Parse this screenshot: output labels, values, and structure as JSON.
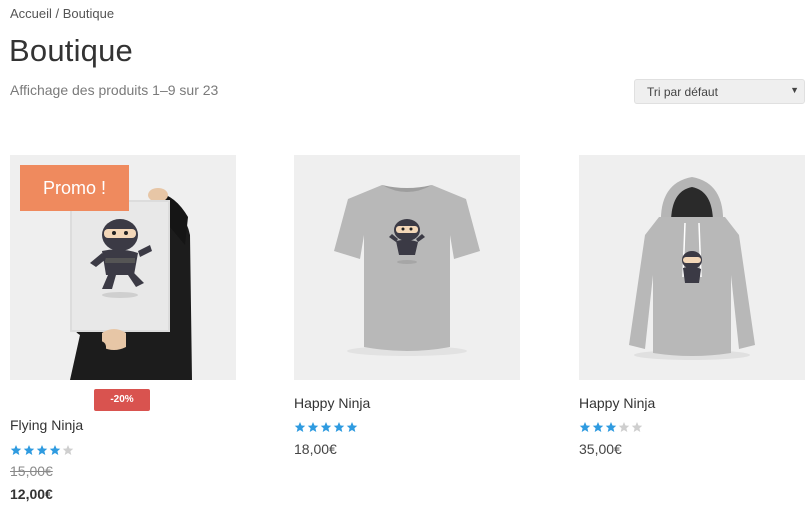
{
  "breadcrumb": {
    "home": "Accueil",
    "separator": " / ",
    "current": "Boutique"
  },
  "page_title": "Boutique",
  "result_count": "Affichage des produits 1–9 sur 23",
  "orderby": {
    "selected": "Tri par défaut"
  },
  "products": [
    {
      "title": "Flying Ninja",
      "rating": 4,
      "regular_price": "15,00€",
      "sale_price": "12,00€",
      "promo_label": "Promo !",
      "discount_label": "-20%",
      "image": "poster-ninja"
    },
    {
      "title": "Happy Ninja",
      "rating": 5,
      "price": "18,00€",
      "image": "tshirt-ninja"
    },
    {
      "title": "Happy Ninja",
      "rating": 3,
      "price": "35,00€",
      "image": "hoodie-ninja"
    }
  ],
  "colors": {
    "star_filled": "#2f9be0",
    "star_empty": "#cfcfcf",
    "promo": "#ef8a5e",
    "discount": "#d9534f"
  },
  "icons": {
    "star": "star-icon",
    "dropdown": "chevron-down-icon"
  }
}
